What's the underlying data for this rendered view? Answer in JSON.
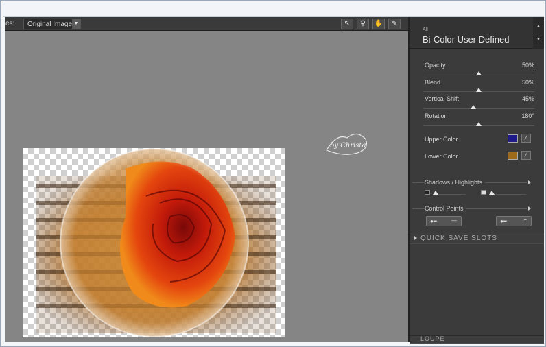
{
  "toolbar": {
    "preview_label": "es:",
    "preview_value": "Original Image",
    "tools": [
      "pointer-icon",
      "zoom-icon",
      "hand-icon",
      "eyedropper-icon"
    ]
  },
  "filter": {
    "category": "All",
    "name": "Bi-Color User Defined"
  },
  "params": [
    {
      "label": "Opacity",
      "value": "50%",
      "level": 0.5
    },
    {
      "label": "Blend",
      "value": "50%",
      "level": 0.5
    },
    {
      "label": "Vertical Shift",
      "value": "45%",
      "level": 0.45
    },
    {
      "label": "Rotation",
      "value": "180°",
      "level": 0.5
    }
  ],
  "colors": {
    "upper_label": "Upper Color",
    "upper_hex": "#1e1a8c",
    "lower_label": "Lower Color",
    "lower_hex": "#9c6a18"
  },
  "shadows_highlights": "Shadows / Highlights",
  "control_points": "Control Points",
  "quick_save": "QUICK SAVE SLOTS",
  "loupe": "LOUPE",
  "watermark_text": "by Christa"
}
